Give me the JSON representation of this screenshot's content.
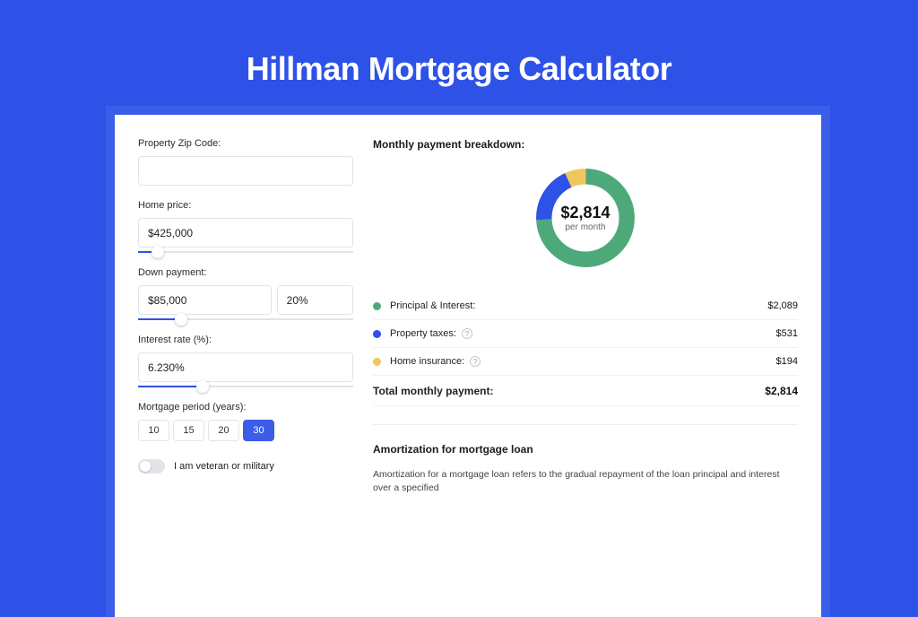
{
  "title": "Hillman Mortgage Calculator",
  "colors": {
    "accent": "#2e52e8",
    "bg": "#3b5de8",
    "pi": "#4ea97a",
    "tax": "#2e52e8",
    "ins": "#f0c75e"
  },
  "form": {
    "zip_label": "Property Zip Code:",
    "zip_value": "",
    "price_label": "Home price:",
    "price_value": "$425,000",
    "price_slider_pct": 9,
    "down_label": "Down payment:",
    "down_value": "$85,000",
    "down_pct_value": "20%",
    "down_slider_pct": 20,
    "rate_label": "Interest rate (%):",
    "rate_value": "6.230%",
    "rate_slider_pct": 30,
    "period_label": "Mortgage period (years):",
    "period_options": [
      "10",
      "15",
      "20",
      "30"
    ],
    "period_active_index": 3,
    "vet_label": "I am veteran or military",
    "vet_on": false
  },
  "breakdown": {
    "heading": "Monthly payment breakdown:",
    "donut": {
      "amount": "$2,814",
      "sub": "per month"
    },
    "rows": [
      {
        "label": "Principal & Interest:",
        "value": "$2,089",
        "color_key": "pi",
        "info": false
      },
      {
        "label": "Property taxes:",
        "value": "$531",
        "color_key": "tax",
        "info": true
      },
      {
        "label": "Home insurance:",
        "value": "$194",
        "color_key": "ins",
        "info": true
      }
    ],
    "total_label": "Total monthly payment:",
    "total_value": "$2,814"
  },
  "amort": {
    "heading": "Amortization for mortgage loan",
    "text": "Amortization for a mortgage loan refers to the gradual repayment of the loan principal and interest over a specified"
  },
  "chart_data": {
    "type": "pie",
    "title": "Monthly payment breakdown",
    "categories": [
      "Principal & Interest",
      "Property taxes",
      "Home insurance"
    ],
    "values": [
      2089,
      531,
      194
    ],
    "total": 2814,
    "colors": [
      "#4ea97a",
      "#2e52e8",
      "#f0c75e"
    ]
  }
}
